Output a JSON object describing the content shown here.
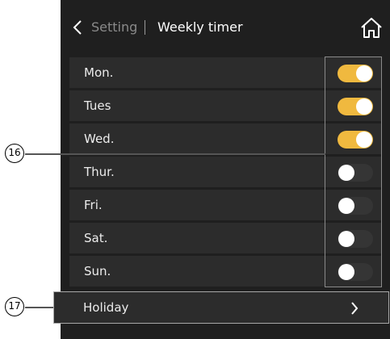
{
  "header": {
    "back_label": "Setting",
    "title": "Weekly timer"
  },
  "days": [
    {
      "label": "Mon.",
      "on": true
    },
    {
      "label": "Tues",
      "on": true
    },
    {
      "label": "Wed.",
      "on": true
    },
    {
      "label": "Thur.",
      "on": false
    },
    {
      "label": "Fri.",
      "on": false
    },
    {
      "label": "Sat.",
      "on": false
    },
    {
      "label": "Sun.",
      "on": false
    }
  ],
  "holiday": {
    "label": "Holiday"
  },
  "callouts": {
    "toggles": "16",
    "holiday": "17"
  },
  "colors": {
    "toggle_on": "#f0b93f",
    "toggle_off": "#353535",
    "background": "#1f1f1f",
    "row": "#2c2c2c"
  }
}
